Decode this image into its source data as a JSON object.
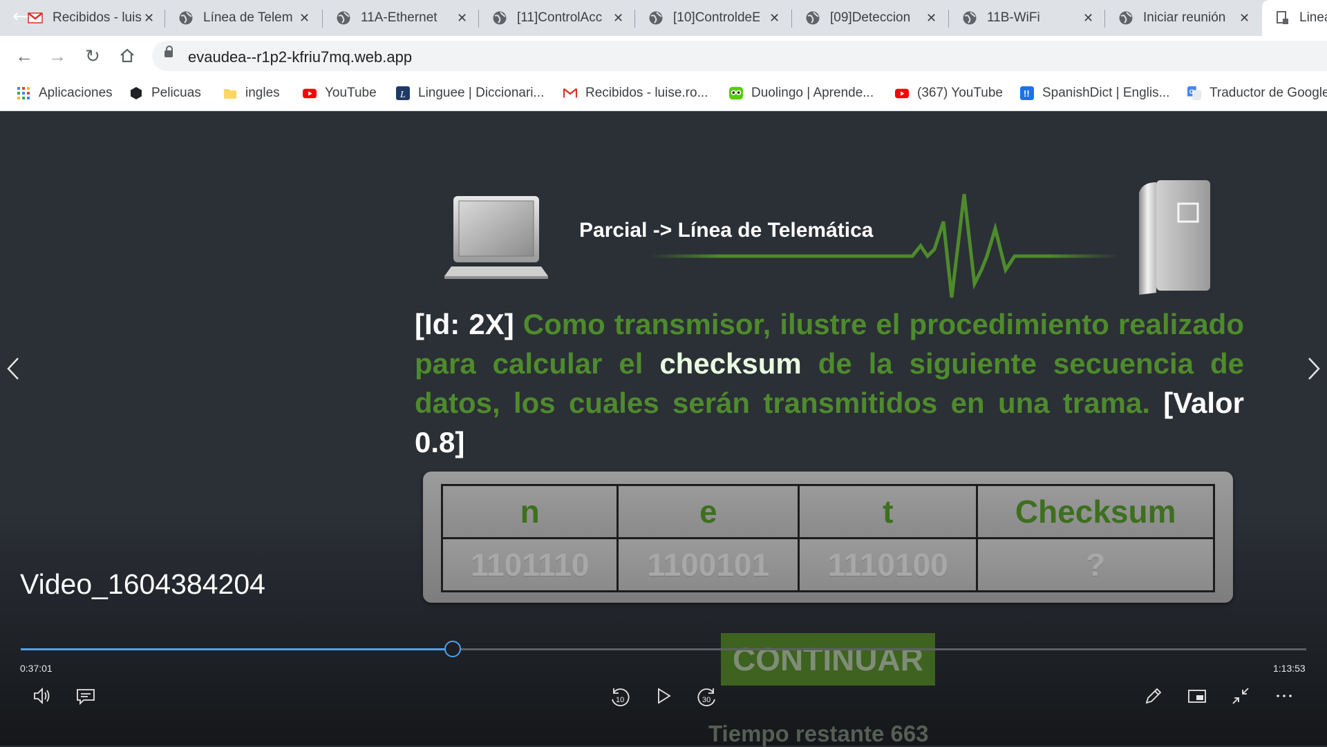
{
  "browser": {
    "tabs": [
      {
        "title": "Recibidos - luis",
        "icon": "gmail-icon"
      },
      {
        "title": "Línea de Telem",
        "icon": "globe-icon"
      },
      {
        "title": "11A-Ethernet",
        "icon": "globe-icon"
      },
      {
        "title": "[11]ControlAcc",
        "icon": "globe-icon"
      },
      {
        "title": "[10]ControldeE",
        "icon": "globe-icon"
      },
      {
        "title": "[09]Deteccion",
        "icon": "globe-icon"
      },
      {
        "title": "11B-WiFi",
        "icon": "globe-icon"
      },
      {
        "title": "Iniciar reunión",
        "icon": "globe-icon"
      },
      {
        "title": "Linea",
        "icon": "page-icon"
      }
    ],
    "url": "evaudea--r1p2-kfriu7mq.web.app",
    "bookmarks": [
      {
        "label": "Aplicaciones",
        "icon": "apps-grid-icon",
        "color": "#4285f4"
      },
      {
        "label": "Pelicuas",
        "icon": "hexagon-icon",
        "color": "#202124"
      },
      {
        "label": "ingles",
        "icon": "folder-icon",
        "color": "#fdd663"
      },
      {
        "label": "YouTube",
        "icon": "youtube-icon",
        "color": "#ff0000"
      },
      {
        "label": "Linguee | Diccionari...",
        "icon": "linguee-icon",
        "color": "#1f3a66"
      },
      {
        "label": "Recibidos - luise.ro...",
        "icon": "gmail-icon",
        "color": "#d93025"
      },
      {
        "label": "Duolingo | Aprende...",
        "icon": "duolingo-icon",
        "color": "#58cc02"
      },
      {
        "label": "(367) YouTube",
        "icon": "youtube-icon",
        "color": "#ff0000"
      },
      {
        "label": "SpanishDict | Englis...",
        "icon": "spanishdict-icon",
        "color": "#1a73e8"
      },
      {
        "label": "Traductor de Google",
        "icon": "google-translate-icon",
        "color": "#4285f4"
      }
    ]
  },
  "slide": {
    "header": "Parcial -> Línea de Telemática",
    "question": {
      "id": "[Id:  2X]",
      "part1": "Como transmisor, ilustre el procedimiento realizado para calcular el",
      "highlight": "checksum",
      "part2": "de la siguiente secuencia de datos, los cuales serán transmitidos en una trama.",
      "value": "[Valor 0.8]"
    },
    "table": {
      "headers": [
        "n",
        "e",
        "t",
        "Checksum"
      ],
      "values": [
        "1101110",
        "1100101",
        "1110100",
        "?"
      ]
    },
    "continue_label": "CONTINUAR",
    "remaining_time": "Tiempo restante 663"
  },
  "player": {
    "title": "Video_1604384204",
    "current_time": "0:37:01",
    "duration": "1:13:53",
    "progress_fraction": 0.336,
    "accent": "#4aa3f0"
  }
}
